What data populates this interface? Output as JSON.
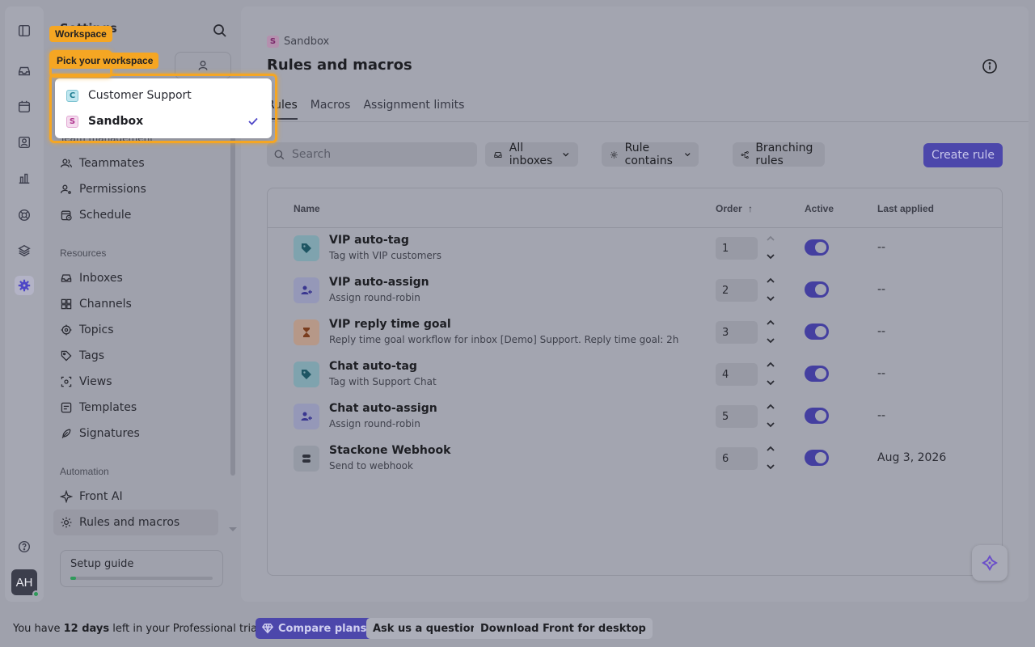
{
  "sidebar": {
    "title": "Settings",
    "partial_section": "Team management",
    "sections": [
      {
        "label": "Resources"
      },
      {
        "label": "Automation"
      }
    ],
    "items": [
      {
        "label": "Teammates",
        "icon": "users-icon"
      },
      {
        "label": "Permissions",
        "icon": "user-key-icon"
      },
      {
        "label": "Schedule",
        "icon": "calendar-clock-icon"
      },
      {
        "label": "Inboxes",
        "icon": "inbox-icon"
      },
      {
        "label": "Channels",
        "icon": "grid-icon"
      },
      {
        "label": "Topics",
        "icon": "target-icon"
      },
      {
        "label": "Tags",
        "icon": "tag-icon"
      },
      {
        "label": "Views",
        "icon": "views-icon"
      },
      {
        "label": "Templates",
        "icon": "template-icon"
      },
      {
        "label": "Signatures",
        "icon": "feather-icon"
      },
      {
        "label": "Front AI",
        "icon": "sparkle-icon"
      },
      {
        "label": "Rules and macros",
        "icon": "gear-icon"
      }
    ],
    "setup_guide": {
      "label": "Setup guide",
      "progress": 0.04
    }
  },
  "rail": {
    "avatar_initials": "AH"
  },
  "workspace_popover": {
    "options": [
      {
        "badge": "C",
        "label": "Customer Support",
        "selected": false
      },
      {
        "badge": "S",
        "label": "Sandbox",
        "selected": true
      }
    ]
  },
  "highlights": {
    "workspace_label": "Workspace",
    "pick_label": "Pick your workspace"
  },
  "main": {
    "breadcrumb": {
      "badge": "S",
      "label": "Sandbox"
    },
    "title": "Rules and macros",
    "tabs": [
      {
        "label": "Rules",
        "active": true
      },
      {
        "label": "Macros",
        "active": false
      },
      {
        "label": "Assignment limits",
        "active": false
      }
    ],
    "search_placeholder": "Search",
    "filters": {
      "inboxes": "All inboxes",
      "rule_contains": "Rule contains",
      "branching": "Branching rules"
    },
    "create_label": "Create rule",
    "columns": {
      "name": "Name",
      "order": "Order",
      "active": "Active",
      "last_applied": "Last applied"
    },
    "rows": [
      {
        "name": "VIP auto-tag",
        "desc": "Tag with VIP customers",
        "order": "1",
        "active": true,
        "last_applied": "--",
        "icon": "tag-icon"
      },
      {
        "name": "VIP auto-assign",
        "desc": "Assign round-robin",
        "order": "2",
        "active": true,
        "last_applied": "--",
        "icon": "assign-icon"
      },
      {
        "name": "VIP reply time goal",
        "desc": "Reply time goal workflow for inbox [Demo] Support. Reply time goal: 2h",
        "order": "3",
        "active": true,
        "last_applied": "--",
        "icon": "hourglass-icon"
      },
      {
        "name": "Chat auto-tag",
        "desc": "Tag with Support Chat",
        "order": "4",
        "active": true,
        "last_applied": "--",
        "icon": "tag-icon"
      },
      {
        "name": "Chat auto-assign",
        "desc": "Assign round-robin",
        "order": "5",
        "active": true,
        "last_applied": "--",
        "icon": "assign-icon"
      },
      {
        "name": "Stackone Webhook",
        "desc": "Send to webhook",
        "order": "6",
        "active": true,
        "last_applied": "Aug 3, 2026",
        "icon": "webhook-icon"
      }
    ]
  },
  "bottom": {
    "trial_prefix": "You have ",
    "trial_days": "12 days",
    "trial_suffix": " left in your Professional trial",
    "compare": "Compare plans",
    "ask": "Ask us a question",
    "download": "Download Front for desktop"
  },
  "colors": {
    "accent": "#4e46c7",
    "highlight": "#f5a623"
  }
}
